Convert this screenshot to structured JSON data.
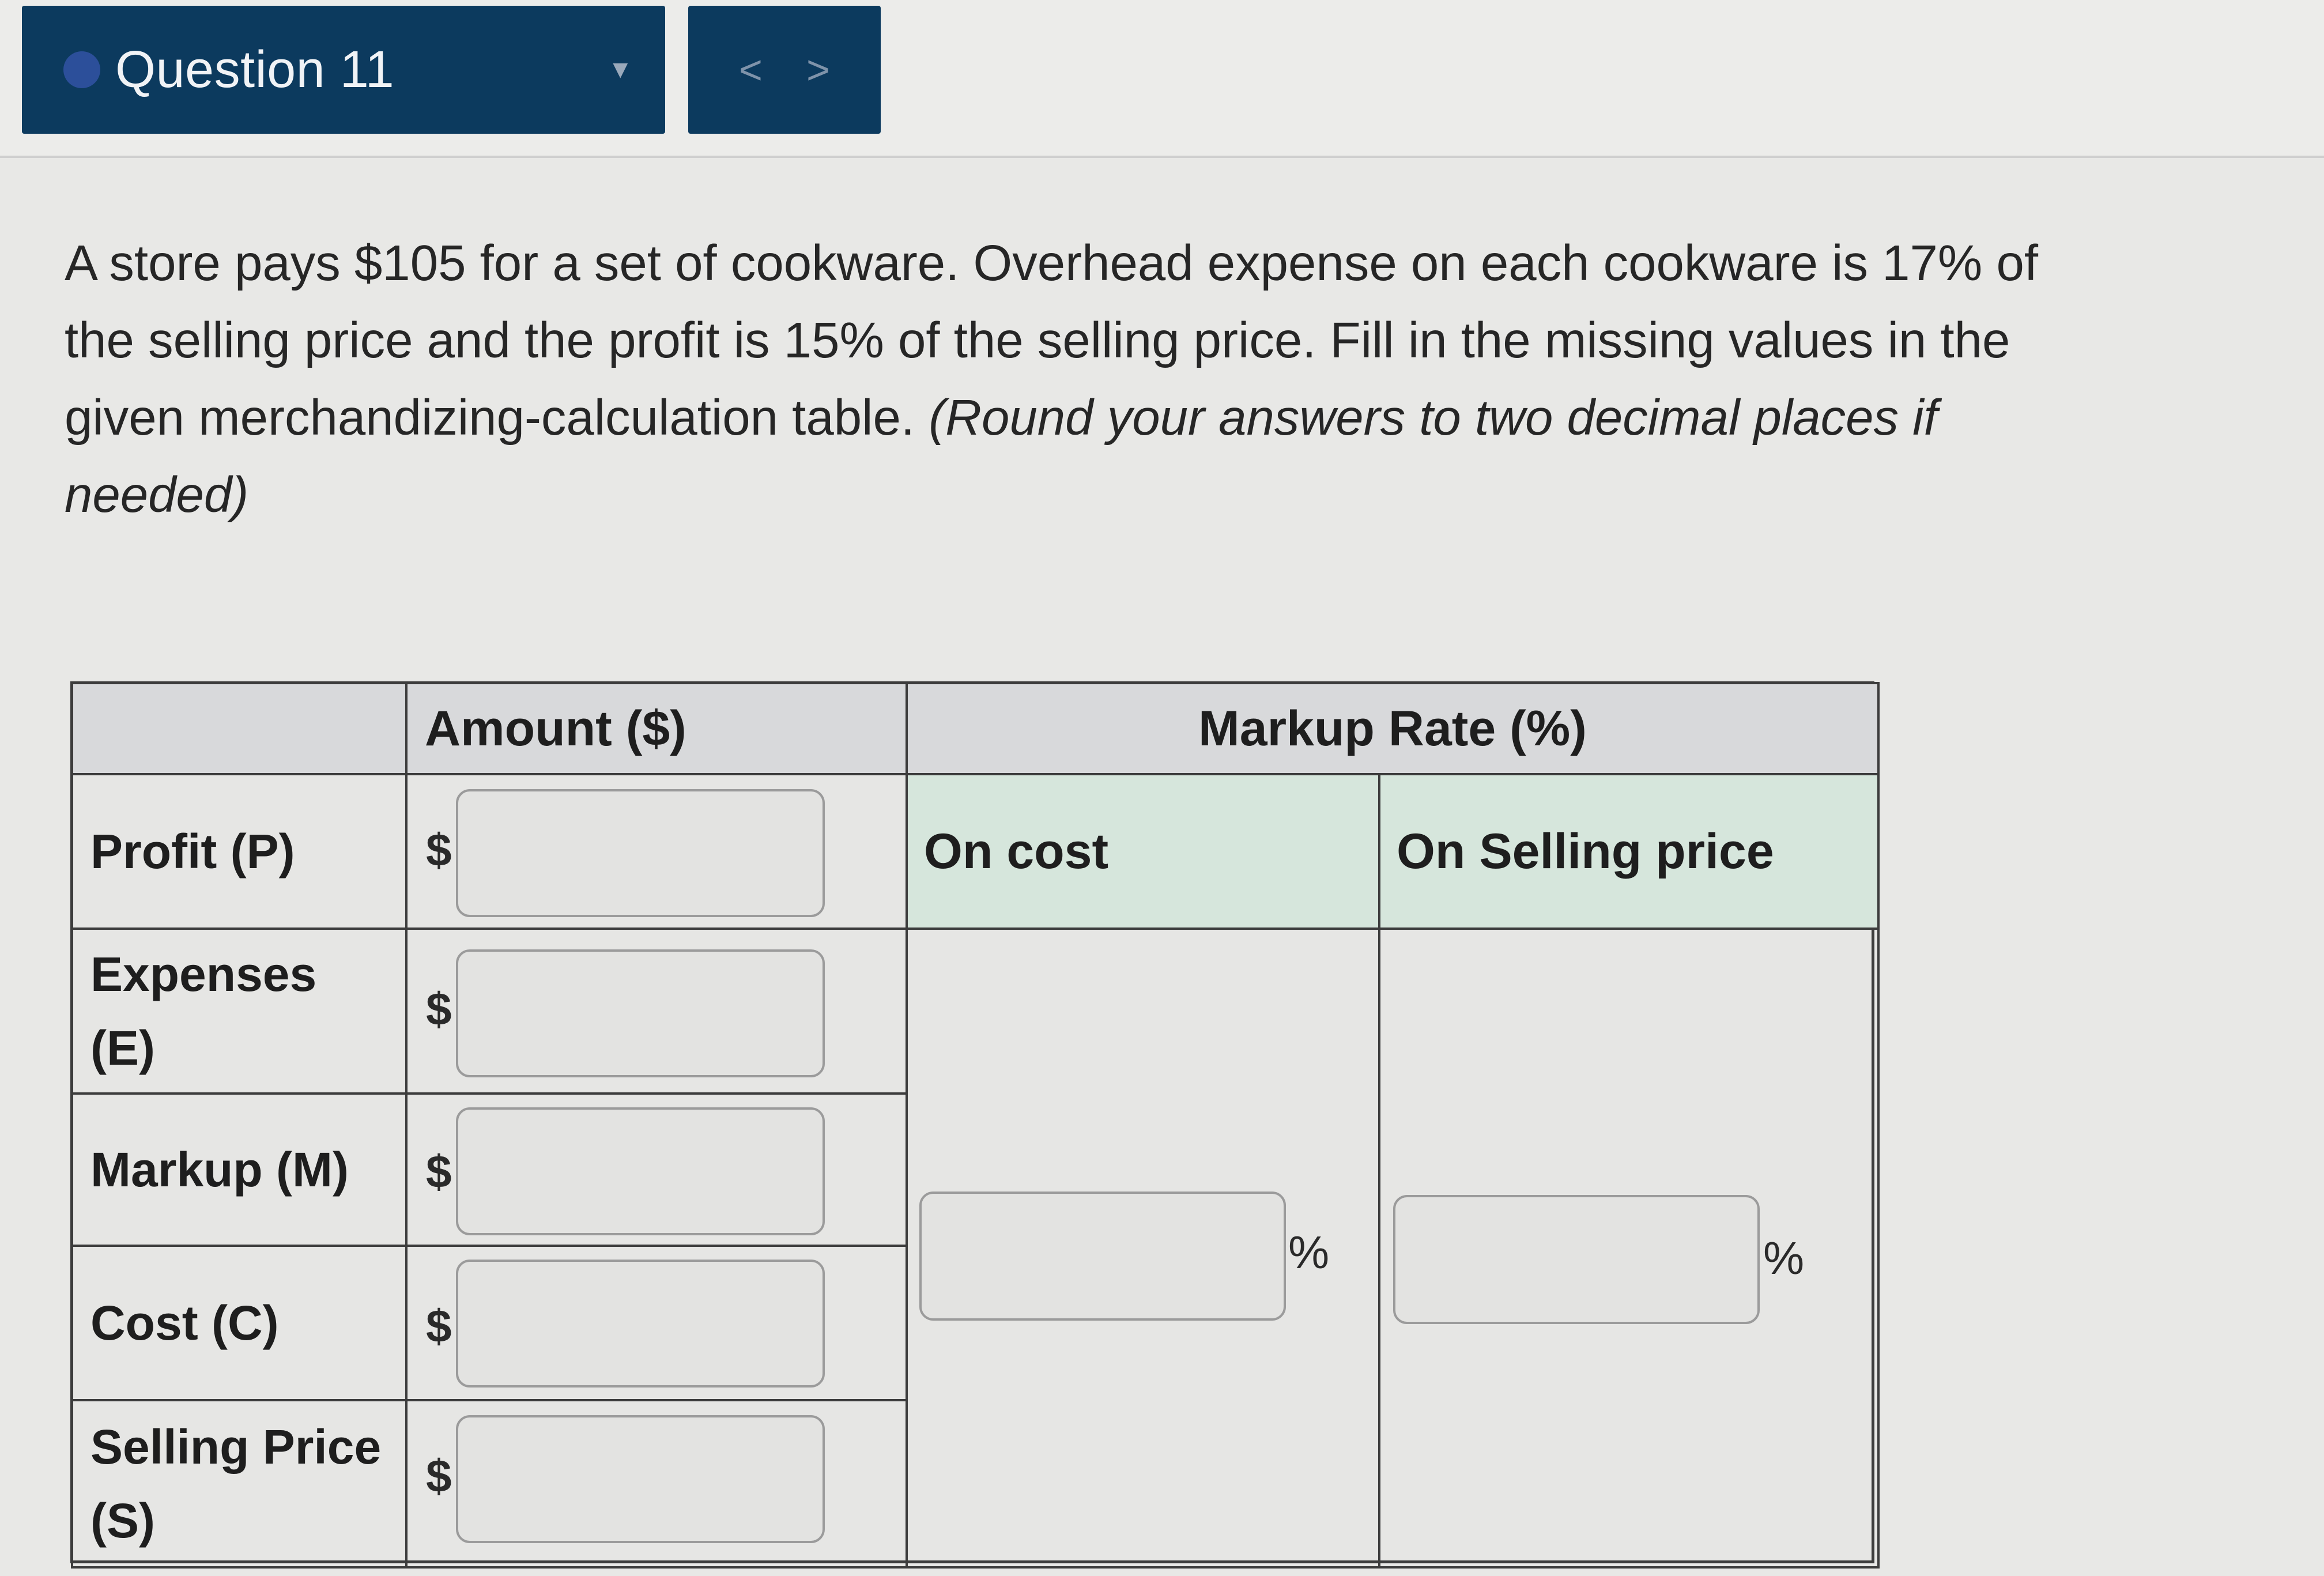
{
  "header": {
    "question_label": "Question 11",
    "prev_label": "<",
    "next_label": ">"
  },
  "question": {
    "text": "A store pays $105 for a set of cookware. Overhead expense on each cookware is 17% of the selling price and the profit is 15% of the selling price. Fill in the missing values in the given merchandizing-calculation table. ",
    "hint": "(Round your answers to two decimal places if needed)"
  },
  "table": {
    "col_amount": "Amount ($)",
    "col_markup_rate": "Markup Rate (%)",
    "sub_on_cost": "On cost",
    "sub_on_selling": "On Selling price",
    "rows": [
      {
        "label": "Profit (P)",
        "currency": "$"
      },
      {
        "label": "Expenses (E)",
        "currency": "$"
      },
      {
        "label": "Markup (M)",
        "currency": "$"
      },
      {
        "label": "Cost (C)",
        "currency": "$"
      },
      {
        "label": "Selling Price (S)",
        "currency": "$"
      }
    ],
    "percent_symbol": "%"
  }
}
